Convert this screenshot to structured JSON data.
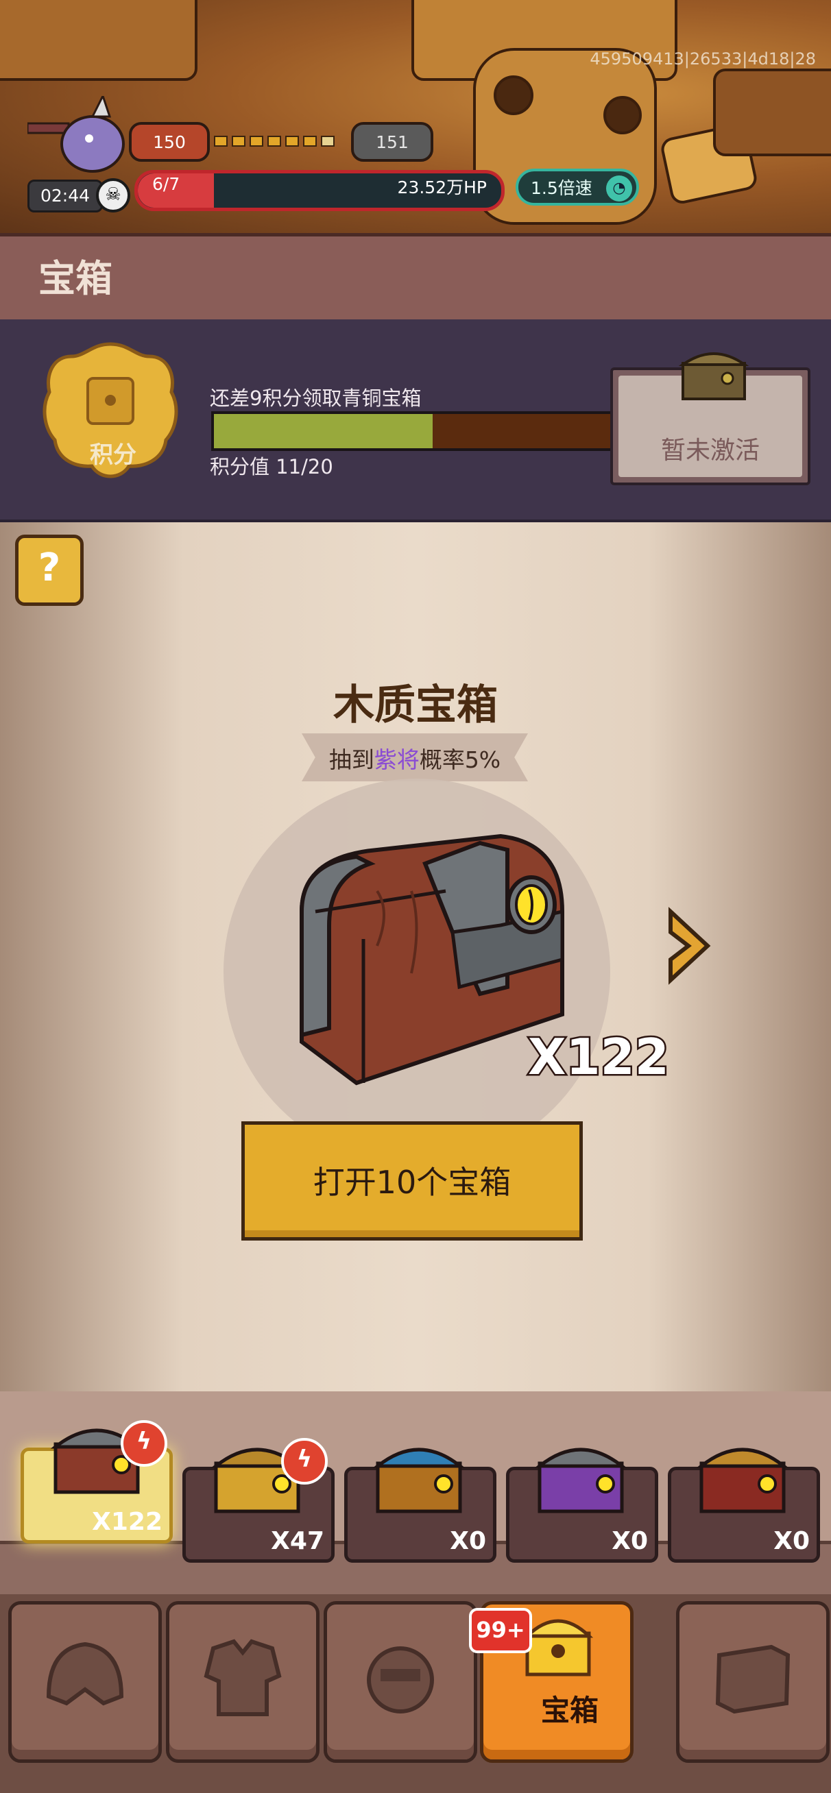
{
  "top_bar": {
    "uid": "459509413|26533|4d18|28",
    "level_current": "150",
    "level_next": "151",
    "wave": "6/7",
    "hp": "23.52万HP",
    "hp_progress": 0.21,
    "speed_label": "1.5倍速",
    "timer": "02:44"
  },
  "section": {
    "title": "宝箱"
  },
  "points": {
    "badge_label": "积分",
    "hint": "还差9积分领取青铜宝箱",
    "value_label": "积分值 11/20",
    "progress": 0.55,
    "bronze_status": "暂未激活"
  },
  "chest": {
    "title": "木质宝箱",
    "rate_prefix": "抽到",
    "rate_highlight": "紫将",
    "rate_suffix": "概率5%",
    "count": "X122",
    "open_button": "打开10个宝箱"
  },
  "chest_tray": [
    {
      "count": "X122",
      "color": "#8b3a2a",
      "badge": true,
      "active": true
    },
    {
      "count": "X47",
      "color": "#d5a32e",
      "badge": true,
      "active": false
    },
    {
      "count": "X0",
      "color": "#2f7fb5",
      "badge": false,
      "active": false
    },
    {
      "count": "X0",
      "color": "#7a3fa8",
      "badge": false,
      "active": false
    },
    {
      "count": "X0",
      "color": "#8a2a22",
      "badge": false,
      "active": false
    }
  ],
  "bottom_nav": {
    "chest_label": "宝箱",
    "badge": "99+"
  },
  "colors": {
    "accent_orange": "#f08b25",
    "hp_red": "#d73c3f",
    "progress_green": "#98a93c",
    "button_yellow": "#e4ac2c"
  }
}
